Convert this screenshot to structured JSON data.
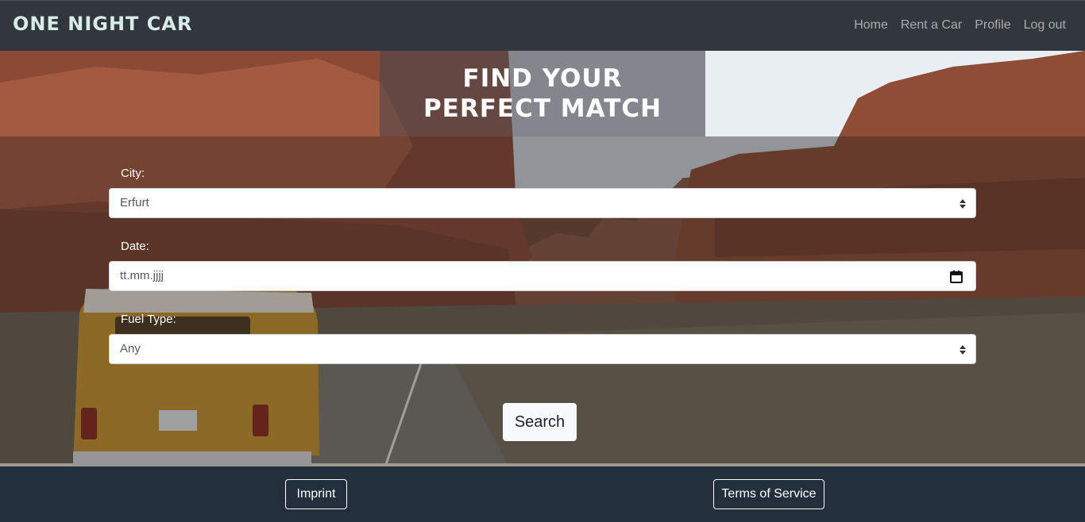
{
  "navbar": {
    "brand": "One Night Car",
    "links": [
      {
        "label": "Home"
      },
      {
        "label": "Rent a Car"
      },
      {
        "label": "Profile"
      },
      {
        "label": "Log out"
      }
    ]
  },
  "hero": {
    "title": "Find your perfect match"
  },
  "form": {
    "city_label": "City:",
    "city_value": "Erfurt",
    "date_label": "Date:",
    "date_placeholder": "tt.mm.jjjj",
    "fuel_label": "Fuel Type:",
    "fuel_value": "Any",
    "search_label": "Search"
  },
  "footer": {
    "imprint_label": "Imprint",
    "terms_label": "Terms of Service"
  },
  "colors": {
    "navbar_bg": "#32373e",
    "brand_color": "#d7ecea",
    "footer_bg": "#22303e"
  },
  "icons": [
    "select-caret-icon",
    "calendar-icon"
  ]
}
